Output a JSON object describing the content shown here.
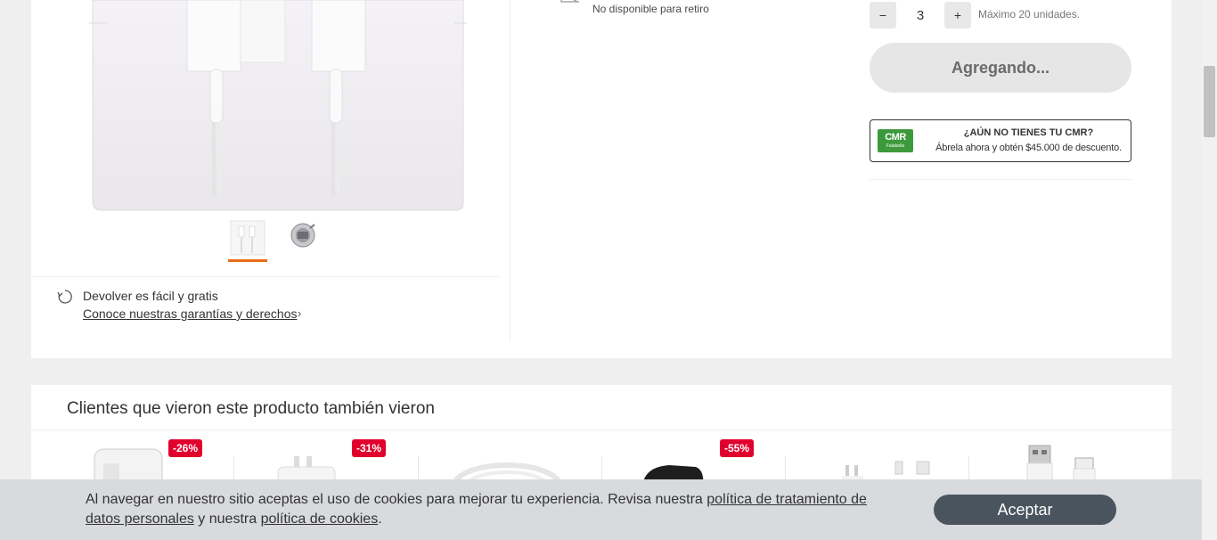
{
  "pickup": {
    "text": "No disponible para retiro",
    "icon": "store-unavailable-icon"
  },
  "quantity": {
    "minus": "−",
    "value": "3",
    "plus": "+",
    "max_text": "Máximo 20 unidades."
  },
  "add_button": {
    "label": "Agregando..."
  },
  "cmr": {
    "logo_text": "CMR",
    "logo_sub": "Falabella",
    "title": "¿AÚN NO TIENES TU CMR?",
    "subtitle": "Ábrela ahora y obtén $45.000 de descuento."
  },
  "gallery": {
    "main_image": "product-box-photo",
    "thumbnails": [
      {
        "image": "box-thumbnail",
        "active": true
      },
      {
        "image": "adapter-thumbnail",
        "active": false
      }
    ]
  },
  "returns": {
    "title": "Devolver es fácil y gratis",
    "link": "Conoce nuestras garantías y derechos",
    "icon": "return-icon"
  },
  "recommendations": {
    "title": "Clientes que vieron este producto también vieron",
    "products": [
      {
        "badge": "-26%",
        "image": "power-adapter-square"
      },
      {
        "badge": "-31%",
        "image": "power-adapter-plug"
      },
      {
        "badge": "",
        "image": "usb-cable-coil"
      },
      {
        "badge": "-55%",
        "image": "car-charger-black"
      },
      {
        "badge": "",
        "image": "charger-cable-kit"
      },
      {
        "badge": "",
        "image": "usb-c-adapter"
      }
    ]
  },
  "cookie_banner": {
    "text_before": "Al navegar en nuestro sitio aceptas el uso de cookies para mejorar tu experiencia. Revisa nuestra ",
    "link_privacy": "política de tratamiento de datos personales",
    "text_middle": " y nuestra ",
    "link_cookies": "política de cookies",
    "text_end": ".",
    "accept_label": "Aceptar"
  },
  "colors": {
    "accent_orange": "#ea6a17",
    "discount_red": "#e1002d",
    "cmr_green": "#3d9a3c",
    "cookie_button": "#4a545e"
  }
}
